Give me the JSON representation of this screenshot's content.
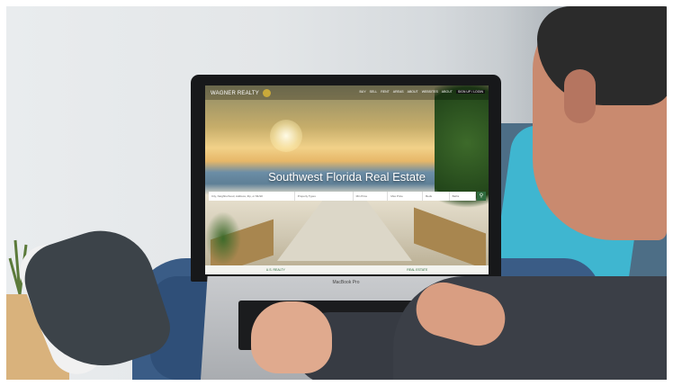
{
  "site": {
    "logo": "WAGNER REALTY",
    "nav": [
      "BUY",
      "SELL",
      "RENT",
      "AREAS",
      "ABOUT",
      "WEBSITES",
      "ABOUT"
    ],
    "signup": "SIGN UP / LOGIN",
    "hero_title": "Southwest Florida Real Estate",
    "search": {
      "location": "City, Neighborhood, Address, Zip, or MLS#",
      "property_type": "Property Types",
      "min_price": "Min Price",
      "max_price": "Max Price",
      "beds": "Beds",
      "baths": "Baths"
    },
    "footer_logos": [
      "U.S. REALTY",
      "REAL ESTATE"
    ]
  },
  "laptop": {
    "brand": "MacBook Pro"
  },
  "colors": {
    "accent": "#2f6b3e",
    "logo_gold": "#c9a93a",
    "cushion": "#3fb6d0"
  }
}
